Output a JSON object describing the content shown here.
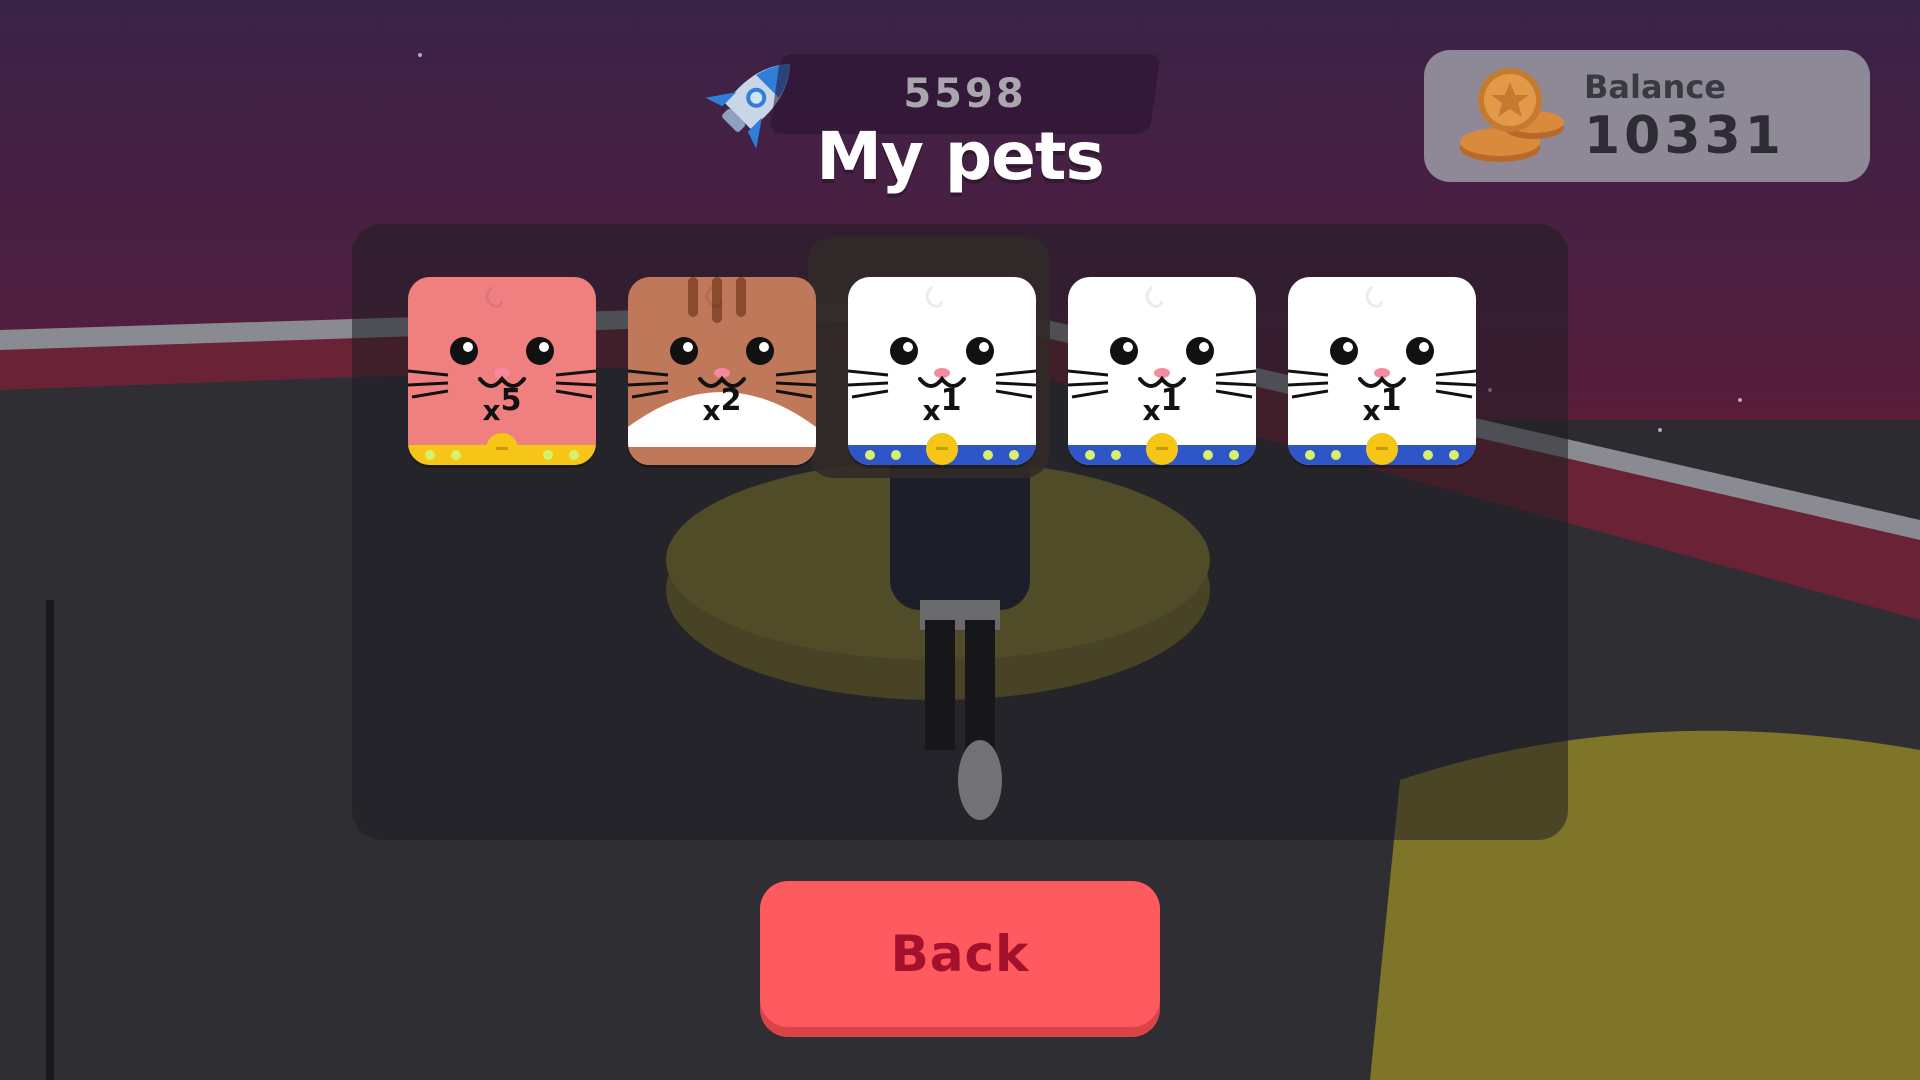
{
  "hud": {
    "score": "5598",
    "title": "My pets",
    "balance_label": "Balance",
    "balance_value": "10331"
  },
  "pets": [
    {
      "type": "pink-cat",
      "count_prefix": "x",
      "count": "5",
      "bg": "#f08080",
      "collar": "#f5c518"
    },
    {
      "type": "tabby-cat",
      "count_prefix": "x",
      "count": "2",
      "bg": "#c0785a",
      "collar": "#ffffff"
    },
    {
      "type": "white-cat",
      "count_prefix": "x",
      "count": "1",
      "bg": "#ffffff",
      "collar": "#2f56c8"
    },
    {
      "type": "white-cat",
      "count_prefix": "x",
      "count": "1",
      "bg": "#ffffff",
      "collar": "#2f56c8"
    },
    {
      "type": "white-cat",
      "count_prefix": "x",
      "count": "1",
      "bg": "#ffffff",
      "collar": "#2f56c8"
    }
  ],
  "buttons": {
    "back": "Back"
  },
  "colors": {
    "sky_top": "#3a2348",
    "sky_bottom": "#5a1d3a",
    "ground": "#2e2e33",
    "button": "#ff5a5f",
    "button_text": "#a3112d"
  }
}
